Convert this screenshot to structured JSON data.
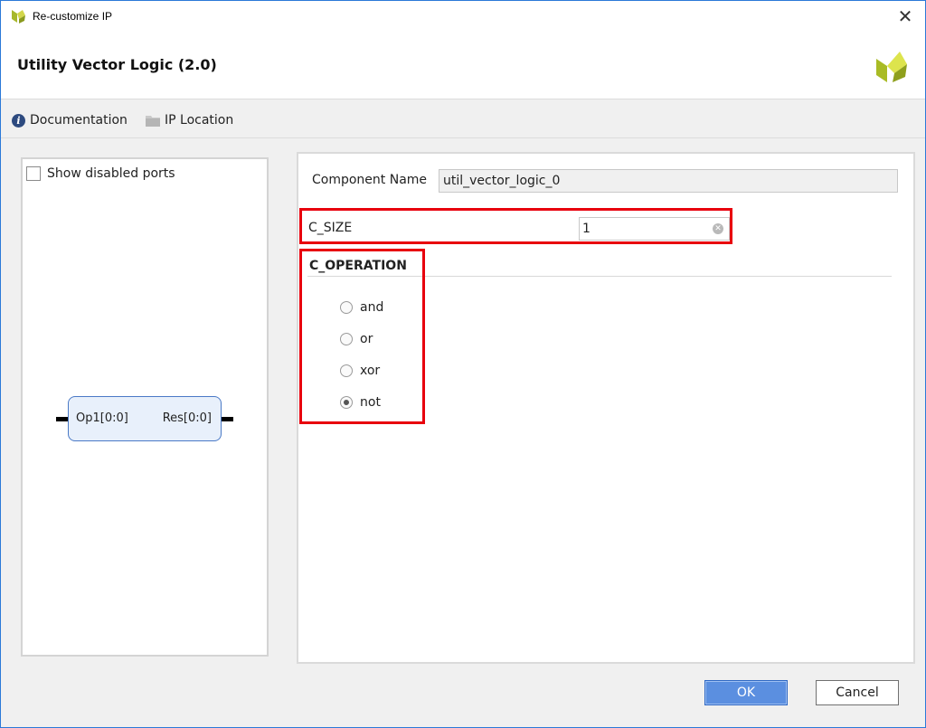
{
  "window": {
    "title": "Re-customize IP",
    "close_glyph": "✕"
  },
  "header": {
    "heading": "Utility Vector Logic (2.0)"
  },
  "toolbar": {
    "documentation_label": "Documentation",
    "ip_location_label": "IP Location"
  },
  "symbol_panel": {
    "show_disabled_ports_label": "Show disabled ports",
    "show_disabled_ports_checked": false,
    "block": {
      "input_port": "Op1[0:0]",
      "output_port": "Res[0:0]"
    }
  },
  "params": {
    "component_name_label": "Component Name",
    "component_name_value": "util_vector_logic_0",
    "c_size_label": "C_SIZE",
    "c_size_value": "1",
    "c_operation_title": "C_OPERATION",
    "operations": [
      {
        "label": "and",
        "checked": false
      },
      {
        "label": "or",
        "checked": false
      },
      {
        "label": "xor",
        "checked": false
      },
      {
        "label": "not",
        "checked": true
      }
    ]
  },
  "footer": {
    "ok_label": "OK",
    "cancel_label": "Cancel"
  },
  "colors": {
    "accent": "#5b8fe0",
    "highlight": "#e8000d",
    "logo": "#b7c727"
  }
}
